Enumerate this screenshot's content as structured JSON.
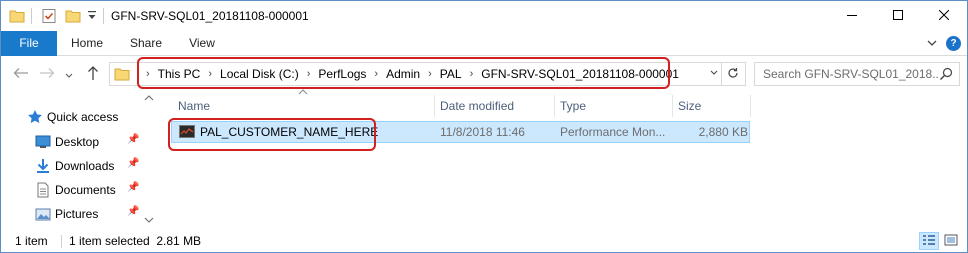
{
  "window": {
    "title": "GFN-SRV-SQL01_20181108-000001"
  },
  "ribbon": {
    "tabs": [
      {
        "label": "File"
      },
      {
        "label": "Home"
      },
      {
        "label": "Share"
      },
      {
        "label": "View"
      }
    ],
    "help_label": "?"
  },
  "address_bar": {
    "crumbs": [
      "This PC",
      "Local Disk (C:)",
      "PerfLogs",
      "Admin",
      "PAL",
      "GFN-SRV-SQL01_20181108-000001"
    ]
  },
  "search": {
    "placeholder": "Search GFN-SRV-SQL01_2018..."
  },
  "nav_pane": {
    "items": [
      {
        "label": "Quick access",
        "icon": "star-icon",
        "pinned": false
      },
      {
        "label": "Desktop",
        "icon": "desktop-folder-icon",
        "pinned": true
      },
      {
        "label": "Downloads",
        "icon": "downloads-folder-icon",
        "pinned": true
      },
      {
        "label": "Documents",
        "icon": "documents-folder-icon",
        "pinned": true
      },
      {
        "label": "Pictures",
        "icon": "pictures-folder-icon",
        "pinned": true
      }
    ]
  },
  "file_list": {
    "columns": [
      "Name",
      "Date modified",
      "Type",
      "Size"
    ],
    "rows": [
      {
        "name": "PAL_CUSTOMER_NAME_HERE",
        "date_modified": "11/8/2018 11:46",
        "type": "Performance Mon...",
        "size": "2,880 KB",
        "selected": true
      }
    ]
  },
  "status_bar": {
    "item_count": "1 item",
    "selection": "1 item selected  2.81 MB"
  },
  "colors": {
    "file_tab": "#1979ca",
    "selection_bg": "#cce8ff",
    "selection_border": "#99d1ff",
    "annotation_red": "#d21f1f",
    "folder_yellow": "#f8d775"
  }
}
